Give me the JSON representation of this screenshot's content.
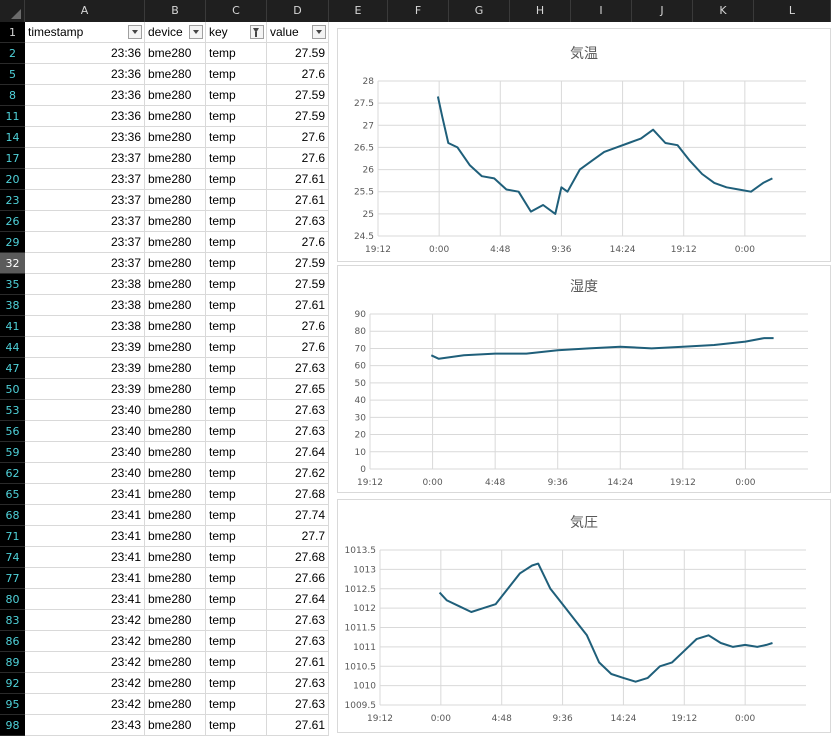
{
  "sheet": {
    "columns": [
      "A",
      "B",
      "C",
      "D",
      "E",
      "F",
      "G",
      "H",
      "I",
      "J",
      "K",
      "L"
    ],
    "header_row": {
      "row_number": "1",
      "cells": [
        "timestamp",
        "device",
        "key",
        "value"
      ]
    },
    "selected_row": "32",
    "rows": [
      {
        "n": "2",
        "time": "23:36",
        "device": "bme280",
        "key": "temp",
        "value": "27.59"
      },
      {
        "n": "5",
        "time": "23:36",
        "device": "bme280",
        "key": "temp",
        "value": "27.6"
      },
      {
        "n": "8",
        "time": "23:36",
        "device": "bme280",
        "key": "temp",
        "value": "27.59"
      },
      {
        "n": "11",
        "time": "23:36",
        "device": "bme280",
        "key": "temp",
        "value": "27.59"
      },
      {
        "n": "14",
        "time": "23:36",
        "device": "bme280",
        "key": "temp",
        "value": "27.6"
      },
      {
        "n": "17",
        "time": "23:37",
        "device": "bme280",
        "key": "temp",
        "value": "27.6"
      },
      {
        "n": "20",
        "time": "23:37",
        "device": "bme280",
        "key": "temp",
        "value": "27.61"
      },
      {
        "n": "23",
        "time": "23:37",
        "device": "bme280",
        "key": "temp",
        "value": "27.61"
      },
      {
        "n": "26",
        "time": "23:37",
        "device": "bme280",
        "key": "temp",
        "value": "27.63"
      },
      {
        "n": "29",
        "time": "23:37",
        "device": "bme280",
        "key": "temp",
        "value": "27.6"
      },
      {
        "n": "32",
        "time": "23:37",
        "device": "bme280",
        "key": "temp",
        "value": "27.59"
      },
      {
        "n": "35",
        "time": "23:38",
        "device": "bme280",
        "key": "temp",
        "value": "27.59"
      },
      {
        "n": "38",
        "time": "23:38",
        "device": "bme280",
        "key": "temp",
        "value": "27.61"
      },
      {
        "n": "41",
        "time": "23:38",
        "device": "bme280",
        "key": "temp",
        "value": "27.6"
      },
      {
        "n": "44",
        "time": "23:39",
        "device": "bme280",
        "key": "temp",
        "value": "27.6"
      },
      {
        "n": "47",
        "time": "23:39",
        "device": "bme280",
        "key": "temp",
        "value": "27.63"
      },
      {
        "n": "50",
        "time": "23:39",
        "device": "bme280",
        "key": "temp",
        "value": "27.65"
      },
      {
        "n": "53",
        "time": "23:40",
        "device": "bme280",
        "key": "temp",
        "value": "27.63"
      },
      {
        "n": "56",
        "time": "23:40",
        "device": "bme280",
        "key": "temp",
        "value": "27.63"
      },
      {
        "n": "59",
        "time": "23:40",
        "device": "bme280",
        "key": "temp",
        "value": "27.64"
      },
      {
        "n": "62",
        "time": "23:40",
        "device": "bme280",
        "key": "temp",
        "value": "27.62"
      },
      {
        "n": "65",
        "time": "23:41",
        "device": "bme280",
        "key": "temp",
        "value": "27.68"
      },
      {
        "n": "68",
        "time": "23:41",
        "device": "bme280",
        "key": "temp",
        "value": "27.74"
      },
      {
        "n": "71",
        "time": "23:41",
        "device": "bme280",
        "key": "temp",
        "value": "27.7"
      },
      {
        "n": "74",
        "time": "23:41",
        "device": "bme280",
        "key": "temp",
        "value": "27.68"
      },
      {
        "n": "77",
        "time": "23:41",
        "device": "bme280",
        "key": "temp",
        "value": "27.66"
      },
      {
        "n": "80",
        "time": "23:41",
        "device": "bme280",
        "key": "temp",
        "value": "27.64"
      },
      {
        "n": "83",
        "time": "23:42",
        "device": "bme280",
        "key": "temp",
        "value": "27.63"
      },
      {
        "n": "86",
        "time": "23:42",
        "device": "bme280",
        "key": "temp",
        "value": "27.63"
      },
      {
        "n": "89",
        "time": "23:42",
        "device": "bme280",
        "key": "temp",
        "value": "27.61"
      },
      {
        "n": "92",
        "time": "23:42",
        "device": "bme280",
        "key": "temp",
        "value": "27.63"
      },
      {
        "n": "95",
        "time": "23:42",
        "device": "bme280",
        "key": "temp",
        "value": "27.63"
      },
      {
        "n": "98",
        "time": "23:43",
        "device": "bme280",
        "key": "temp",
        "value": "27.61"
      }
    ]
  },
  "colors": {
    "series": "#1f5f7a",
    "grid": "#d9d9d9",
    "axis_text": "#595959"
  },
  "chart_data": [
    {
      "type": "line",
      "title": "気温",
      "xticks": [
        "19:12",
        "0:00",
        "4:48",
        "9:36",
        "14:24",
        "19:12",
        "0:00"
      ],
      "yticks": [
        "24.5",
        "25",
        "25.5",
        "26",
        "26.5",
        "27",
        "27.5",
        "28"
      ],
      "ylim": [
        24.5,
        28
      ],
      "xlim": [
        0,
        7
      ],
      "series": [
        {
          "x": [
            0.98,
            1.05,
            1.15,
            1.3,
            1.5,
            1.7,
            1.9,
            2.1,
            2.3,
            2.5,
            2.7,
            2.9,
            3.0,
            3.1,
            3.3,
            3.5,
            3.7,
            3.9,
            4.1,
            4.3,
            4.5,
            4.7,
            4.9,
            5.1,
            5.3,
            5.5,
            5.7,
            5.9,
            6.1,
            6.3,
            6.45
          ],
          "y": [
            27.65,
            27.2,
            26.6,
            26.5,
            26.1,
            25.85,
            25.8,
            25.55,
            25.5,
            25.05,
            25.2,
            25.0,
            25.6,
            25.5,
            26.0,
            26.2,
            26.4,
            26.5,
            26.6,
            26.7,
            26.9,
            26.6,
            26.55,
            26.2,
            25.9,
            25.7,
            25.6,
            25.55,
            25.5,
            25.7,
            25.8
          ]
        }
      ]
    },
    {
      "type": "line",
      "title": "湿度",
      "xticks": [
        "19:12",
        "0:00",
        "4:48",
        "9:36",
        "14:24",
        "19:12",
        "0:00"
      ],
      "yticks": [
        "0",
        "10",
        "20",
        "30",
        "40",
        "50",
        "60",
        "70",
        "80",
        "90"
      ],
      "ylim": [
        0,
        90
      ],
      "xlim": [
        0,
        7
      ],
      "series": [
        {
          "x": [
            0.98,
            1.1,
            1.5,
            2.0,
            2.5,
            3.0,
            3.5,
            4.0,
            4.5,
            5.0,
            5.5,
            6.0,
            6.3,
            6.45
          ],
          "y": [
            66,
            64,
            66,
            67,
            67,
            69,
            70,
            71,
            70,
            71,
            72,
            74,
            76,
            76
          ]
        }
      ]
    },
    {
      "type": "line",
      "title": "気圧",
      "xticks": [
        "19:12",
        "0:00",
        "4:48",
        "9:36",
        "14:24",
        "19:12",
        "0:00"
      ],
      "yticks": [
        "1009.5",
        "1010",
        "1010.5",
        "1011",
        "1011.5",
        "1012",
        "1012.5",
        "1013",
        "1013.5"
      ],
      "ylim": [
        1009.5,
        1013.5
      ],
      "xlim": [
        0,
        7
      ],
      "series": [
        {
          "x": [
            0.98,
            1.1,
            1.3,
            1.5,
            1.7,
            1.9,
            2.1,
            2.3,
            2.5,
            2.6,
            2.8,
            3.0,
            3.2,
            3.4,
            3.6,
            3.8,
            4.0,
            4.2,
            4.4,
            4.6,
            4.8,
            5.0,
            5.2,
            5.4,
            5.6,
            5.8,
            6.0,
            6.2,
            6.35,
            6.45
          ],
          "y": [
            1012.4,
            1012.2,
            1012.05,
            1011.9,
            1012.0,
            1012.1,
            1012.5,
            1012.9,
            1013.1,
            1013.15,
            1012.5,
            1012.1,
            1011.7,
            1011.3,
            1010.6,
            1010.3,
            1010.2,
            1010.1,
            1010.2,
            1010.5,
            1010.6,
            1010.9,
            1011.2,
            1011.3,
            1011.1,
            1011.0,
            1011.05,
            1011.0,
            1011.05,
            1011.1
          ]
        }
      ]
    }
  ]
}
